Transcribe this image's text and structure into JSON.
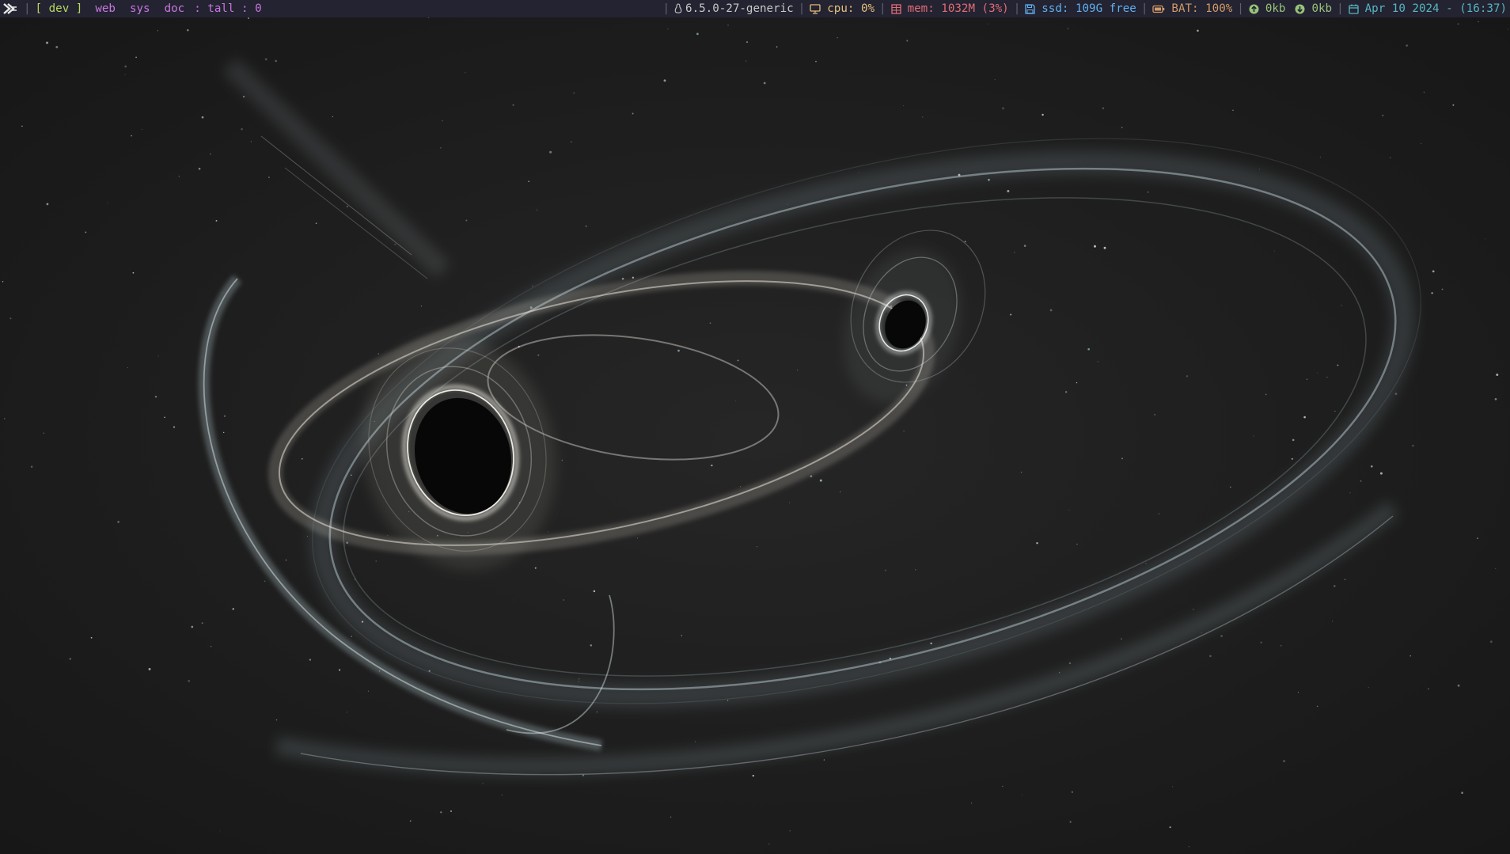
{
  "statusbar": {
    "logo_icon": "xmonad-logo-icon",
    "separator": "|",
    "workspaces": [
      {
        "label": "[ dev ]",
        "active": true
      },
      {
        "label": "web",
        "active": false
      },
      {
        "label": "sys",
        "active": false
      },
      {
        "label": "doc",
        "active": false
      }
    ],
    "layout": ": tall : 0",
    "kernel": {
      "icon": "linux-tux-icon",
      "text": "6.5.0-27-generic"
    },
    "cpu": {
      "icon": "monitor-icon",
      "text": "cpu: 0%"
    },
    "mem": {
      "icon": "memory-icon",
      "text": "mem: 1032M (3%)"
    },
    "ssd": {
      "icon": "floppy-disk-icon",
      "text": "ssd: 109G free"
    },
    "battery": {
      "icon": "battery-icon",
      "text": "BAT: 100%"
    },
    "net_up": {
      "icon": "upload-arrow-icon",
      "text": "0kb"
    },
    "net_down": {
      "icon": "download-arrow-icon",
      "text": "0kb"
    },
    "date": {
      "icon": "calendar-icon",
      "text": "Apr 10 2024 - (16:37)"
    },
    "colors": {
      "bar_bg": "#232331",
      "active_workspace": "#b8d85f",
      "workspace": "#c678dd",
      "cpu": "#e5c07b",
      "mem": "#e06c75",
      "ssd": "#61afef",
      "battery": "#d19a66",
      "net": "#98c379",
      "date": "#56b6c2"
    }
  },
  "wallpaper": {
    "subject": "binary-black-hole-merger-wallpaper"
  }
}
